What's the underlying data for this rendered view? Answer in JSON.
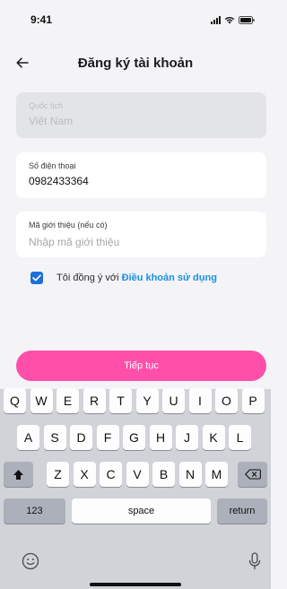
{
  "status_bar": {
    "time": "9:41"
  },
  "nav": {
    "title": "Đăng ký tài khoản"
  },
  "form": {
    "nationality": {
      "label": "Quốc tịch",
      "value": "Việt Nam"
    },
    "phone": {
      "label": "Số điện thoại",
      "value": "0982433364"
    },
    "referral": {
      "label": "Mã giới thiệu (nếu có)",
      "placeholder": "Nhập mã giới thiệu"
    }
  },
  "terms": {
    "text": "Tôi đồng ý với",
    "link": "Điều khoản sử dụng",
    "checked": true
  },
  "continue_label": "Tiếp tục",
  "colors": {
    "accent": "#ff4fa9",
    "link": "#1a8fe6",
    "checkbox": "#1f6fdb"
  },
  "keyboard": {
    "row1": [
      "Q",
      "W",
      "E",
      "R",
      "T",
      "Y",
      "U",
      "I",
      "O",
      "P"
    ],
    "row2": [
      "A",
      "S",
      "D",
      "F",
      "G",
      "H",
      "J",
      "K",
      "L"
    ],
    "row3": [
      "Z",
      "X",
      "C",
      "V",
      "B",
      "N",
      "M"
    ],
    "numbers_label": "123",
    "space_label": "space",
    "return_label": "return"
  }
}
